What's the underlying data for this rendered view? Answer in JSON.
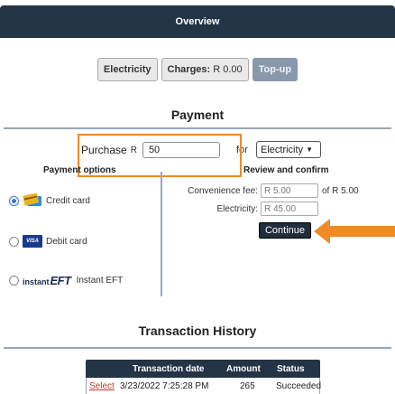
{
  "header": {
    "title": "Overview"
  },
  "tabs": {
    "electricity": "Electricity",
    "charges_label": "Charges:",
    "charges_amount": "R 0.00",
    "topup": "Top-up"
  },
  "payment": {
    "title": "Payment",
    "purchase_label": "Purchase",
    "currency": "R",
    "amount_value": "50",
    "for_label": "for",
    "product_select": "Electricity",
    "options_title": "Payment options",
    "review_title": "Review and confirm",
    "options": [
      {
        "label": "Credit card",
        "selected": true,
        "icon": "credit-card-icon"
      },
      {
        "label": "Debit card",
        "selected": false,
        "icon": "visa-icon",
        "icon_text": "VISA"
      },
      {
        "label": "Instant EFT",
        "selected": false,
        "icon": "instant-eft-logo",
        "logo_small": "instant",
        "logo_big": "EFT"
      }
    ],
    "convenience_fee_label": "Convenience fee:",
    "convenience_fee_value": "R 5.00",
    "of_label": "of R 5.00",
    "electricity_label": "Electricity:",
    "electricity_value": "R 45.00",
    "continue_label": "Continue"
  },
  "history": {
    "title": "Transaction History",
    "columns": [
      "Transaction date",
      "Amount",
      "Status"
    ],
    "rows": [
      {
        "action": "Select",
        "date": "3/23/2022 7:25:28 PM",
        "amount": "265",
        "status": "Succeeded"
      }
    ]
  },
  "colors": {
    "header_bg": "#243447",
    "accent_orange": "#f08a24",
    "link_red": "#c0392b"
  }
}
